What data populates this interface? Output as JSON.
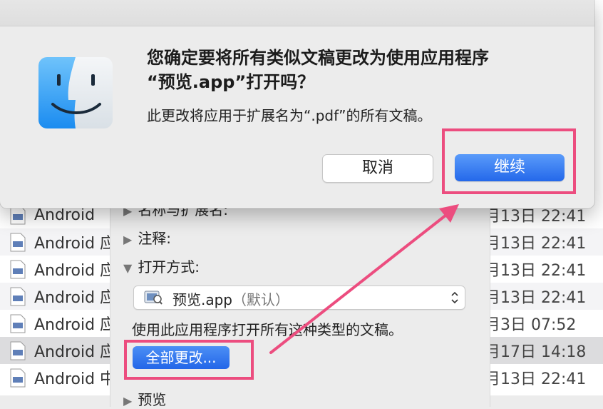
{
  "file_list": {
    "rows": [
      {
        "name": "Android",
        "date": "月13日 22:41"
      },
      {
        "name": "Android 应",
        "date": "月13日 22:41"
      },
      {
        "name": "Android 应",
        "date": "月13日 22:41"
      },
      {
        "name": "Android 应",
        "date": "月13日 22:41"
      },
      {
        "name": "Android 应",
        "date": "月3日 07:52"
      },
      {
        "name": "Android 应",
        "date": "月17日 14:18"
      },
      {
        "name": "Android 中",
        "date": "月13日 22:41"
      }
    ]
  },
  "info_panel": {
    "name_ext_label": "名称与扩展名:",
    "comments_label": "注释:",
    "open_with_label": "打开方式:",
    "app_name": "预览.app",
    "app_default": "（默认）",
    "help_text": "使用此应用程序打开所有这种类型的文稿。",
    "change_all_label": "全部更改...",
    "preview_label": "预览"
  },
  "dialog": {
    "icon": "finder-icon",
    "title_line1": "您确定要将所有类似文稿更改为使用应用程序",
    "title_line2": "“预览.app”打开吗？",
    "message": "此更改将应用于扩展名为“.pdf”的所有文稿。",
    "cancel_label": "取消",
    "continue_label": "继续"
  },
  "colors": {
    "accent_blue": "#2468ea",
    "highlight_pink": "#ec4d7f"
  }
}
